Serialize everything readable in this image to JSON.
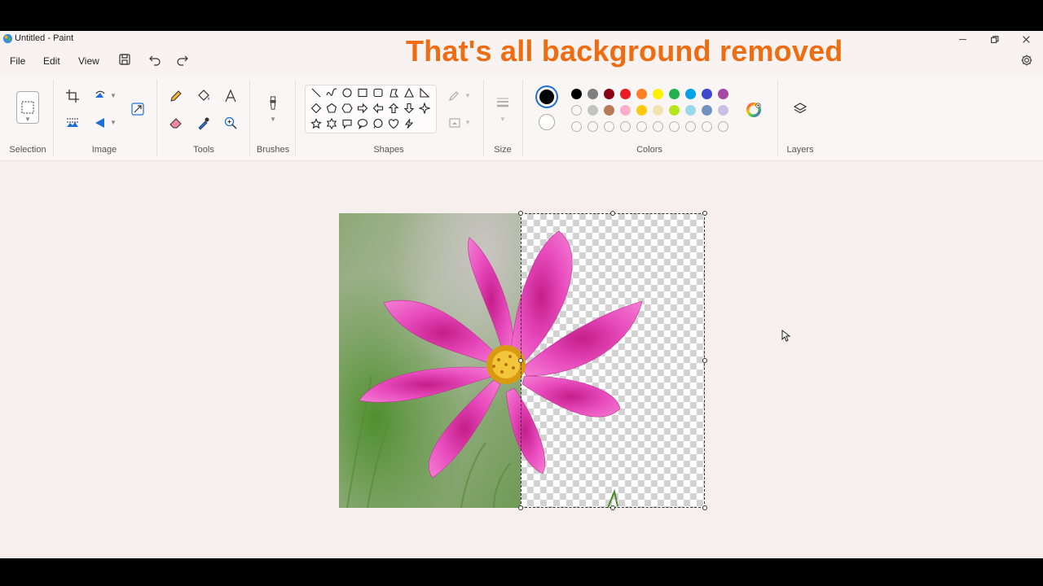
{
  "window": {
    "title": "Untitled - Paint",
    "controls": [
      "minimize-icon",
      "restore-icon",
      "close-icon"
    ]
  },
  "menu": {
    "items": [
      "File",
      "Edit",
      "View"
    ]
  },
  "quick_access": [
    "save-icon",
    "undo-icon",
    "redo-icon"
  ],
  "overlay": {
    "text": "That's all background removed",
    "color": "#ee6d13"
  },
  "ribbon": {
    "groups": {
      "selection": "Selection",
      "image": "Image",
      "tools": "Tools",
      "brushes": "Brushes",
      "shapes": "Shapes",
      "size": "Size",
      "colors": "Colors",
      "layers": "Layers"
    },
    "primary_color": "#000000",
    "secondary_color": "#ffffff",
    "palette_row1": [
      "#000000",
      "#7f7f7f",
      "#880015",
      "#ed1c24",
      "#ff7f27",
      "#fff200",
      "#22b14c",
      "#00a2e8",
      "#3f48cc",
      "#a349a4"
    ],
    "palette_row2": [
      "#ffffff",
      "#c3c3c3",
      "#b97a57",
      "#ffaec9",
      "#ffc90e",
      "#efe4b0",
      "#b5e61d",
      "#99d9ea",
      "#7092be",
      "#c8bfe7"
    ]
  }
}
